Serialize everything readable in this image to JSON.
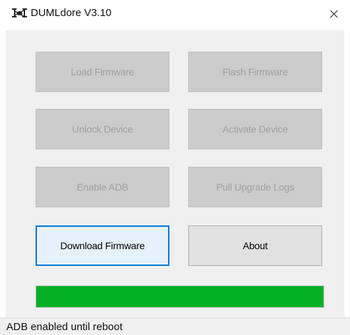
{
  "window": {
    "title": "DUMLdore V3.10",
    "app_icon": "drone-icon",
    "close_icon": "close-icon"
  },
  "buttons": {
    "load_firmware": {
      "label": "Load Firmware",
      "enabled": false
    },
    "flash_firmware": {
      "label": "Flash Firmware",
      "enabled": false
    },
    "unlock_device": {
      "label": "Unlock Device",
      "enabled": false
    },
    "activate_device": {
      "label": "Activate Device",
      "enabled": false
    },
    "enable_adb": {
      "label": "Enable ADB",
      "enabled": false
    },
    "pull_upgrade_logs": {
      "label": "Pull Upgrade Logs",
      "enabled": false
    },
    "download_firmware": {
      "label": "Download Firmware",
      "enabled": true,
      "focused": true
    },
    "about": {
      "label": "About",
      "enabled": true
    }
  },
  "progress": {
    "value_percent": 100,
    "color": "#06b025"
  },
  "status": {
    "text": "ADB enabled until reboot"
  },
  "colors": {
    "focus_border": "#0078d7",
    "progress_green": "#06b025"
  }
}
